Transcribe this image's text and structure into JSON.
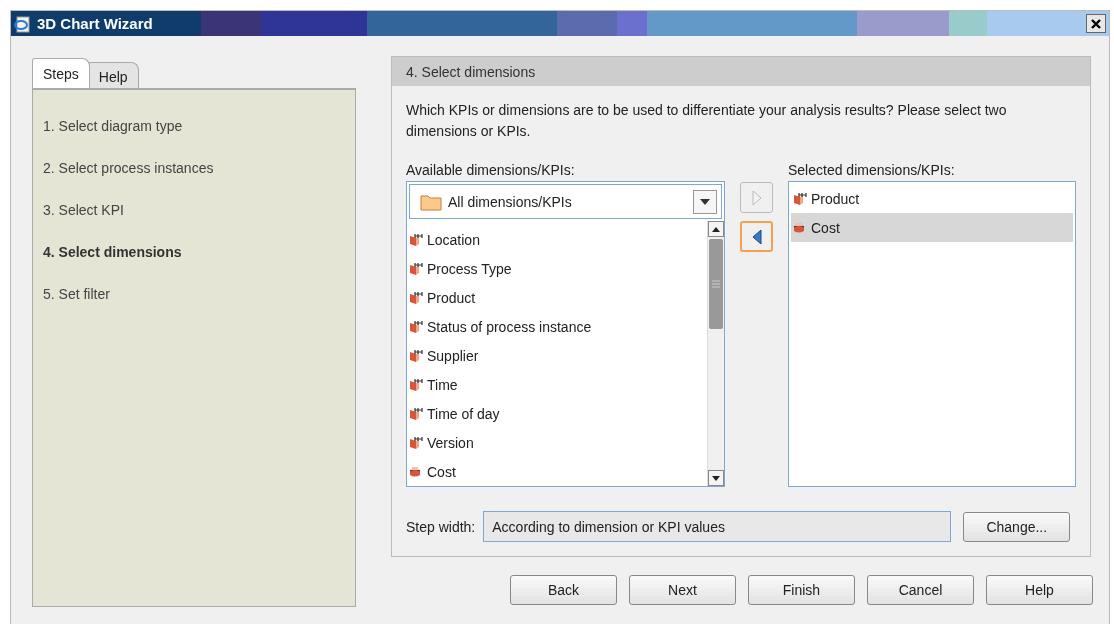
{
  "window": {
    "title": "3D Chart Wizard"
  },
  "tabs": [
    {
      "label": "Steps",
      "selected": true
    },
    {
      "label": "Help",
      "selected": false
    }
  ],
  "steps": [
    {
      "label": "1. Select diagram type",
      "current": false
    },
    {
      "label": "2. Select process instances",
      "current": false
    },
    {
      "label": "3. Select KPI",
      "current": false
    },
    {
      "label": "4. Select dimensions",
      "current": true
    },
    {
      "label": "5. Set filter",
      "current": false
    }
  ],
  "panel": {
    "title": "4. Select dimensions",
    "instructions": "Which KPIs or dimensions are to be used to differentiate your analysis results? Please select two dimensions or KPIs.",
    "available": {
      "label": "Available dimensions/KPIs:",
      "filter": "All dimensions/KPIs",
      "items": [
        {
          "label": "Location",
          "kind": "dimension",
          "selected": false
        },
        {
          "label": "Process Type",
          "kind": "dimension",
          "selected": false
        },
        {
          "label": "Product",
          "kind": "dimension",
          "selected": false
        },
        {
          "label": "Status of process instance",
          "kind": "dimension",
          "selected": false
        },
        {
          "label": "Supplier",
          "kind": "dimension",
          "selected": false
        },
        {
          "label": "Time",
          "kind": "dimension",
          "selected": false
        },
        {
          "label": "Time of day",
          "kind": "dimension",
          "selected": false
        },
        {
          "label": "Version",
          "kind": "dimension",
          "selected": false
        },
        {
          "label": "Cost",
          "kind": "kpi",
          "selected": false
        }
      ]
    },
    "add_button": {
      "disabled": true
    },
    "remove_button": {
      "disabled": false
    },
    "selected": {
      "label": "Selected dimensions/KPIs:",
      "items": [
        {
          "label": "Product",
          "kind": "dimension",
          "selected": false
        },
        {
          "label": "Cost",
          "kind": "kpi",
          "selected": true
        }
      ]
    },
    "step_width": {
      "label": "Step width:",
      "value": "According to dimension or KPI values",
      "button": "Change..."
    }
  },
  "buttons": [
    "Back",
    "Next",
    "Finish",
    "Cancel",
    "Help"
  ]
}
